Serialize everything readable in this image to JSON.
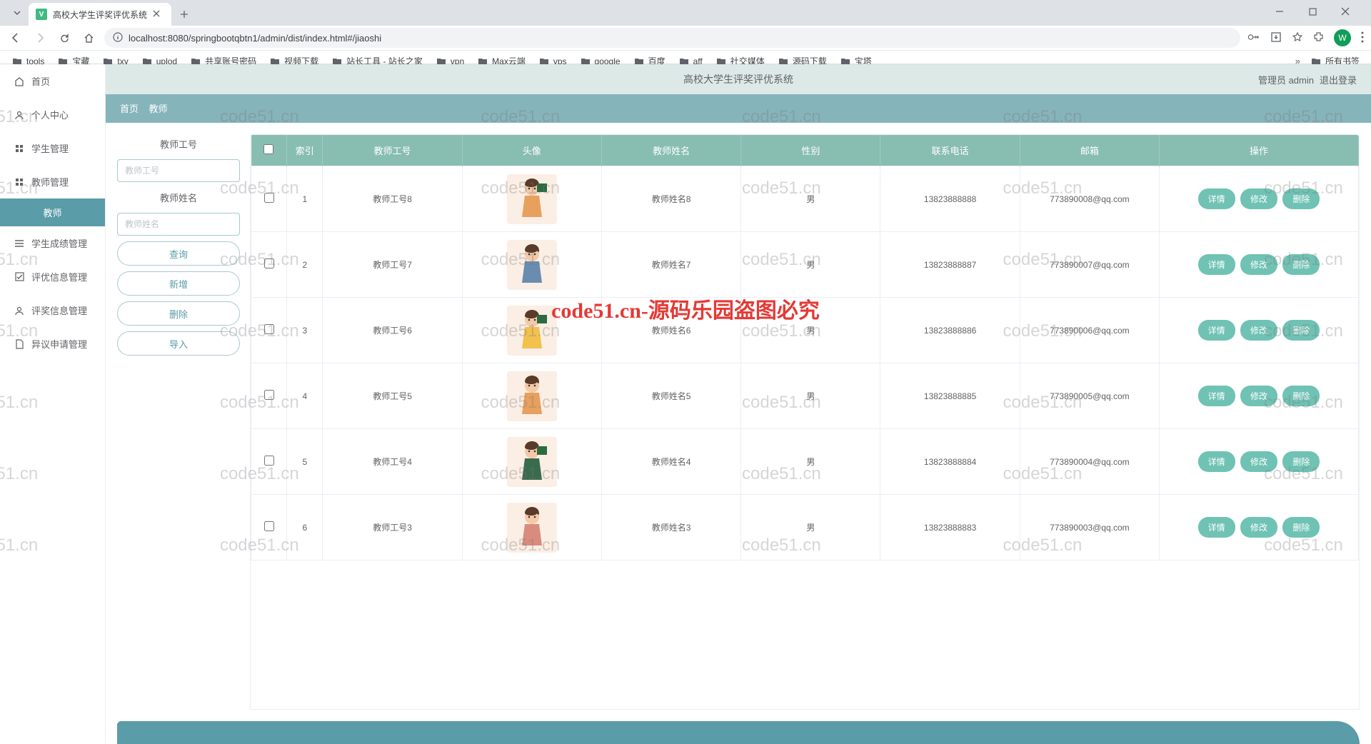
{
  "browser": {
    "tab_title": "高校大学生评奖评优系统",
    "url": "localhost:8080/springbootqbtn1/admin/dist/index.html#/jiaoshi",
    "avatar_letter": "W",
    "bookmarks": [
      "tools",
      "宝藏",
      "txy",
      "uplod",
      "共享账号密码",
      "视频下载",
      "站长工具 - 站长之家",
      "vpn",
      "Max云端",
      "vps",
      "google",
      "百度",
      "aff",
      "社交媒体",
      "源码下载",
      "宝塔"
    ],
    "all_bookmarks": "所有书签"
  },
  "header": {
    "title": "高校大学生评奖评优系统",
    "role": "管理员 admin",
    "logout": "退出登录"
  },
  "breadcrumb": {
    "home": "首页",
    "current": "教师"
  },
  "sidebar": {
    "items": [
      {
        "label": "首页",
        "icon": "home"
      },
      {
        "label": "个人中心",
        "icon": "user"
      },
      {
        "label": "学生管理",
        "icon": "grid"
      },
      {
        "label": "教师管理",
        "icon": "grid"
      },
      {
        "label": "教师",
        "icon": "",
        "active": true
      },
      {
        "label": "学生成绩管理",
        "icon": "list"
      },
      {
        "label": "评优信息管理",
        "icon": "check"
      },
      {
        "label": "评奖信息管理",
        "icon": "user"
      },
      {
        "label": "异议申请管理",
        "icon": "file"
      }
    ]
  },
  "search": {
    "label_id": "教师工号",
    "placeholder_id": "教师工号",
    "label_name": "教师姓名",
    "placeholder_name": "教师姓名",
    "btn_search": "查询",
    "btn_add": "新增",
    "btn_delete": "删除",
    "btn_import": "导入"
  },
  "table": {
    "headers": {
      "idx": "索引",
      "id": "教师工号",
      "avatar": "头像",
      "name": "教师姓名",
      "gender": "性别",
      "phone": "联系电话",
      "email": "邮箱",
      "ops": "操作"
    },
    "ops": {
      "detail": "详情",
      "edit": "修改",
      "delete": "删除"
    },
    "rows": [
      {
        "idx": "1",
        "id": "教师工号8",
        "name": "教师姓名8",
        "gender": "男",
        "phone": "13823888888",
        "email": "773890008@qq.com"
      },
      {
        "idx": "2",
        "id": "教师工号7",
        "name": "教师姓名7",
        "gender": "男",
        "phone": "13823888887",
        "email": "773890007@qq.com"
      },
      {
        "idx": "3",
        "id": "教师工号6",
        "name": "教师姓名6",
        "gender": "男",
        "phone": "13823888886",
        "email": "773890006@qq.com"
      },
      {
        "idx": "4",
        "id": "教师工号5",
        "name": "教师姓名5",
        "gender": "男",
        "phone": "13823888885",
        "email": "773890005@qq.com"
      },
      {
        "idx": "5",
        "id": "教师工号4",
        "name": "教师姓名4",
        "gender": "男",
        "phone": "13823888884",
        "email": "773890004@qq.com"
      },
      {
        "idx": "6",
        "id": "教师工号3",
        "name": "教师姓名3",
        "gender": "男",
        "phone": "13823888883",
        "email": "773890003@qq.com"
      }
    ]
  },
  "watermark": {
    "text": "code51.cn",
    "center": "code51.cn-源码乐园盗图必究"
  }
}
